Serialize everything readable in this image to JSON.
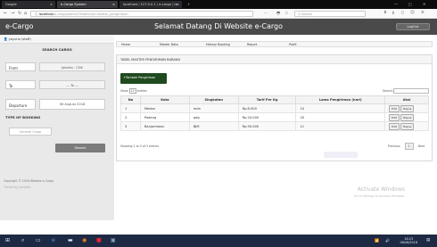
{
  "browser": {
    "tabs": [
      "Google",
      "e-Cargo System",
      "localhost / 127.0.0.1 / e-cargo / ta"
    ],
    "new_tab": "+",
    "url_host": "localhost",
    "url_path": "/e-cargo/admin/Tradmin/m.master_pengiriman",
    "search_placeholder": "Q Search",
    "more": "···"
  },
  "app": {
    "brand": "e-Cargo",
    "welcome": "Selamat Datang Di Website e-Cargo",
    "logout": "LogOut"
  },
  "sidebar": {
    "user": "yoyuno (staff)",
    "search_title": "SEARCH CARGO",
    "from_label": "From",
    "from_value": "Jakarta - CGK",
    "to_label": "To",
    "to_value": "--- To ---",
    "departure_label": "Departure",
    "departure_value": "06 August 2018",
    "booking_title": "TYPE OF BOOKING",
    "booking_value": "General Cargo",
    "search_button": "Search",
    "copyright": "Copyright © 2018 Website e-Cargo",
    "theme": "Theme by Jumbotlc"
  },
  "menu": {
    "items": [
      "Home",
      "Master Data",
      "History Booking",
      "Report",
      "Profil"
    ]
  },
  "panel": {
    "title": "TABEL MASTER PENGIRIMAN BARANG",
    "add_button": "+Tambah Pengiriman",
    "show_prefix": "Show",
    "show_value": "10",
    "show_suffix": "entries",
    "search_label": "Search:",
    "columns": [
      "No",
      "Kota",
      "Singkatan",
      "Tarif Per Kg",
      "Lama Pengiriman (hari)",
      "Aksi"
    ],
    "rows": [
      [
        "1",
        "Medan",
        "mdn",
        "Rp.8.000",
        "10"
      ],
      [
        "2",
        "Padang",
        "pdg",
        "Rp.20.000",
        "20"
      ],
      [
        "3",
        "Banjarmasin",
        "BJM",
        "Rp.90.000",
        "11"
      ]
    ],
    "edit_label": "Edit",
    "delete_label": "Hapus",
    "info": "Showing 1 to 3 of 3 entries",
    "prev": "Previous",
    "page": "1",
    "next": "Next"
  },
  "windows": {
    "activate_title": "Activate Windows",
    "activate_sub": "Go to Settings to activate Windows.",
    "time": "18:23",
    "date": "06/08/2018"
  }
}
